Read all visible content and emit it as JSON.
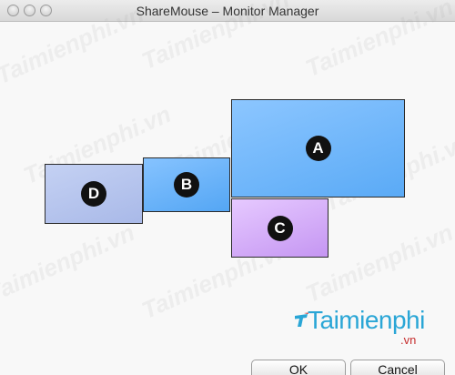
{
  "window": {
    "title": "ShareMouse – Monitor Manager"
  },
  "monitors": [
    {
      "id": "a",
      "label": "A",
      "color": "#6db6fb"
    },
    {
      "id": "b",
      "label": "B",
      "color": "#6ab4fa"
    },
    {
      "id": "c",
      "label": "C",
      "color": "#d6b0fa"
    },
    {
      "id": "d",
      "label": "D",
      "color": "#b7c5ee"
    }
  ],
  "watermark": {
    "text": "Taimienphi.vn"
  },
  "logo": {
    "name": "Taimienphi",
    "suffix": ".vn",
    "brand_color": "#2aa6d6",
    "suffix_color": "#c62f2f"
  },
  "buttons": {
    "ok_label": "OK",
    "cancel_label": "Cancel"
  }
}
